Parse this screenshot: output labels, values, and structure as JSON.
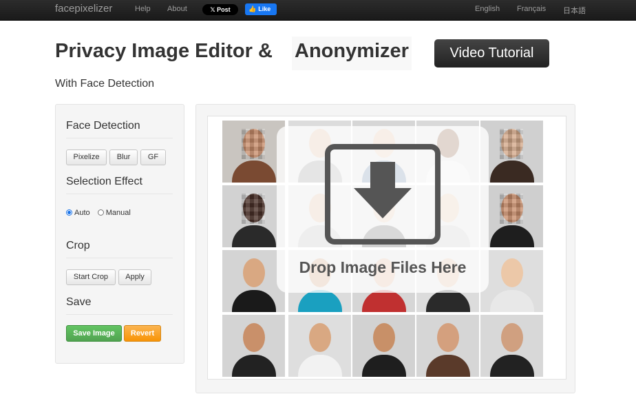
{
  "navbar": {
    "brand": "facepixelizer",
    "links": [
      "Help",
      "About"
    ],
    "x_post": "Post",
    "x_logo": "𝕏",
    "fb_like": "Like",
    "languages": [
      "English",
      "Français",
      "日本語"
    ]
  },
  "header": {
    "title_main": "Privacy Image Editor &",
    "title_highlight": "Anonymizer",
    "video_button": "Video Tutorial",
    "subtitle": "With Face Detection"
  },
  "panel": {
    "face_detection": {
      "title": "Face Detection",
      "buttons": [
        "Pixelize",
        "Blur",
        "GF"
      ]
    },
    "selection_effect": {
      "title": "Selection Effect",
      "options": [
        "Auto",
        "Manual"
      ],
      "selected": "Auto"
    },
    "crop": {
      "title": "Crop",
      "buttons": [
        "Start Crop",
        "Apply"
      ]
    },
    "save": {
      "title": "Save",
      "save_button": "Save Image",
      "revert_button": "Revert"
    }
  },
  "dropzone": {
    "text": "Drop Image Files Here",
    "icon": "download-arrow-icon"
  },
  "colors": {
    "navbar": "#1f1f1f",
    "green": "#5bb75b",
    "orange": "#faa732",
    "dark_button": "#333333"
  }
}
